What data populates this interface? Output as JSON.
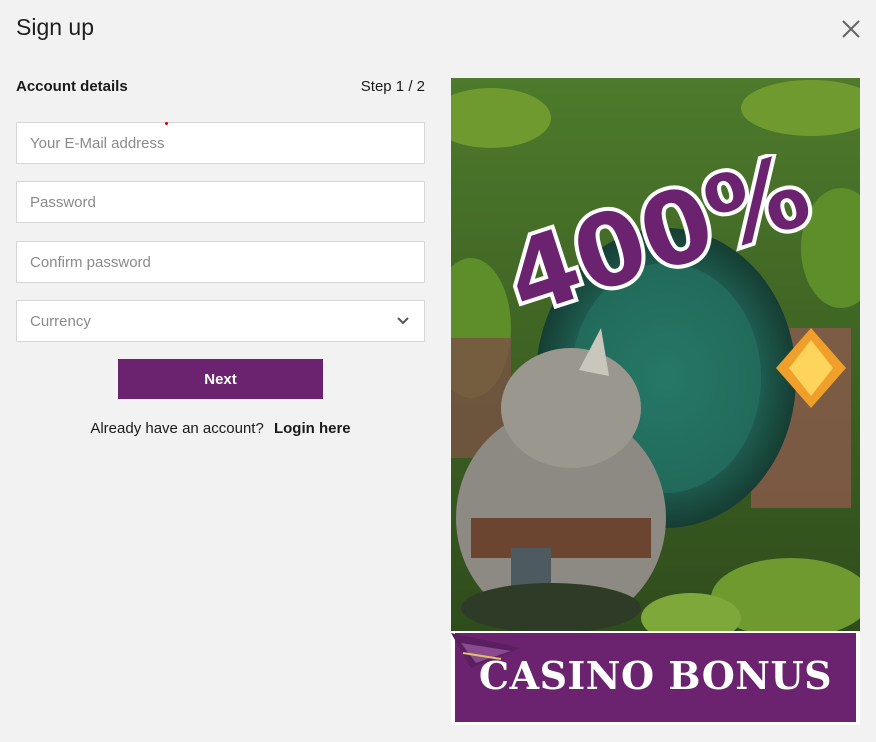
{
  "modal": {
    "title": "Sign up",
    "close_icon": "close-icon"
  },
  "form": {
    "section_title": "Account details",
    "step": "Step 1 / 2",
    "email": {
      "placeholder": "Your E-Mail address",
      "value": ""
    },
    "password": {
      "placeholder": "Password",
      "value": ""
    },
    "confirm_password": {
      "placeholder": "Confirm password",
      "value": ""
    },
    "currency": {
      "selected": "Currency",
      "icon": "chevron-down-icon"
    },
    "next_label": "Next",
    "login_prompt": "Already have an account?",
    "login_link": "Login here"
  },
  "promo": {
    "headline": "400%",
    "bonus_text": "CASINO BONUS",
    "colors": {
      "brand_purple": "#6b236f",
      "jungle_green": "#3f6b2a",
      "portal_teal": "#2c7c6c"
    }
  },
  "colors": {
    "background": "#f2f2f2",
    "button": "#6b236f",
    "input_border": "#d6d6d6",
    "required_marker": "#d40000"
  }
}
